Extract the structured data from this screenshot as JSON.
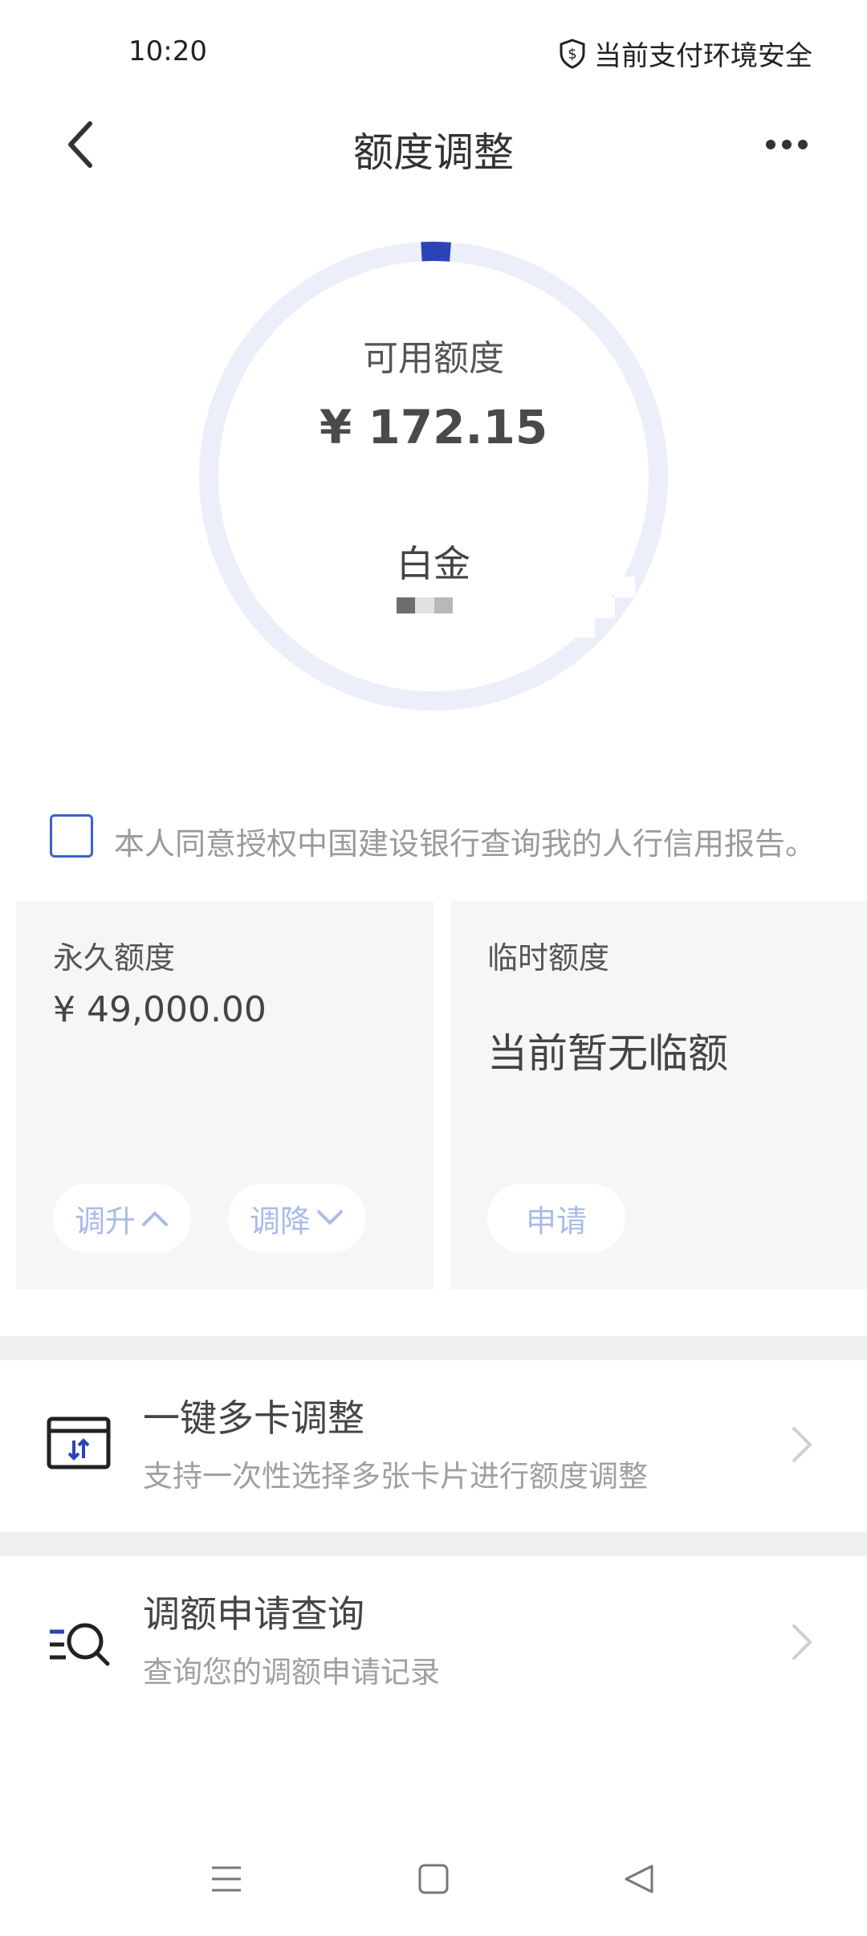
{
  "status_bar": {
    "time": "10:20",
    "security_text": "当前支付环境安全"
  },
  "header": {
    "title": "额度调整"
  },
  "credit_ring": {
    "label": "可用额度",
    "amount": "¥ 172.15",
    "tier": "白金",
    "accent_color": "#2a44b8",
    "track_color": "#eceefa"
  },
  "consent": {
    "text": "本人同意授权中国建设银行查询我的人行信用报告。"
  },
  "permanent_limit": {
    "title": "永久额度",
    "amount": "¥ 49,000.00",
    "increase_label": "调升",
    "decrease_label": "调降"
  },
  "temporary_limit": {
    "title": "临时额度",
    "status": "当前暂无临额",
    "apply_label": "申请"
  },
  "menu": [
    {
      "title": "一键多卡调整",
      "subtitle": "支持一次性选择多张卡片进行额度调整",
      "icon": "card-transfer-icon"
    },
    {
      "title": "调额申请查询",
      "subtitle": "查询您的调额申请记录",
      "icon": "list-search-icon"
    }
  ],
  "system_nav": {
    "icons": [
      "menu-icon",
      "home-icon",
      "back-icon"
    ]
  }
}
